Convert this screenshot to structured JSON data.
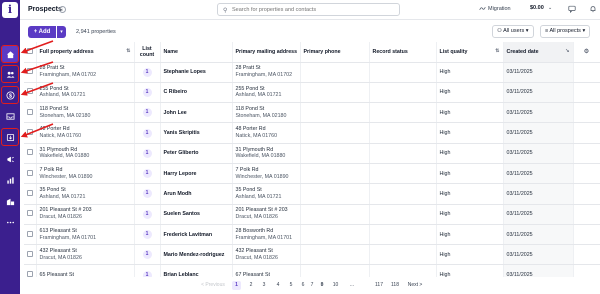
{
  "topbar": {
    "title": "Prospects",
    "search_placeholder": "Search for properties and contacts",
    "migration_label": "Migration",
    "credit_balance": "$0.00"
  },
  "toolbar": {
    "add_label": "+ Add",
    "property_count": "2,941 properties",
    "filter_users": "All users",
    "filter_prospects": "All prospects"
  },
  "table": {
    "columns": {
      "full_address": "Full property address",
      "list_count_1": "List",
      "list_count_2": "count",
      "name": "Name",
      "mailing_address": "Primary mailing address",
      "phone": "Primary phone",
      "record_status": "Record status",
      "list_quality": "List quality",
      "created_date": "Created date"
    },
    "rows": [
      {
        "addr1": "28 Pratt St",
        "addr2": "Framingham, MA 01702",
        "count": "1",
        "name": "Stephanie Lopes",
        "mail1": "28 Pratt St",
        "mail2": "Framingham, MA 01702",
        "quality": "High",
        "created": "03/11/2025"
      },
      {
        "addr1": "255 Pond St",
        "addr2": "Ashland, MA 01721",
        "count": "1",
        "name": "C Ribeiro",
        "mail1": "255 Pond St",
        "mail2": "Ashland, MA 01721",
        "quality": "High",
        "created": "03/11/2025"
      },
      {
        "addr1": "118 Pond St",
        "addr2": "Stoneham, MA 02180",
        "count": "1",
        "name": "John Lee",
        "mail1": "118 Pond St",
        "mail2": "Stoneham, MA 02180",
        "quality": "High",
        "created": "03/11/2025"
      },
      {
        "addr1": "48 Porter Rd",
        "addr2": "Natick, MA 01760",
        "count": "1",
        "name": "Yanis Skripitis",
        "mail1": "48 Porter Rd",
        "mail2": "Natick, MA 01760",
        "quality": "High",
        "created": "03/11/2025"
      },
      {
        "addr1": "31 Plymouth Rd",
        "addr2": "Wakefield, MA 01880",
        "count": "1",
        "name": "Peter Gliberto",
        "mail1": "31 Plymouth Rd",
        "mail2": "Wakefield, MA 01880",
        "quality": "High",
        "created": "03/11/2025"
      },
      {
        "addr1": "7 Polk Rd",
        "addr2": "Winchester, MA 01890",
        "count": "1",
        "name": "Harry Lepore",
        "mail1": "7 Polk Rd",
        "mail2": "Winchester, MA 01890",
        "quality": "High",
        "created": "03/11/2025"
      },
      {
        "addr1": "35 Pond St",
        "addr2": "Ashland, MA 01721",
        "count": "1",
        "name": "Arun Modh",
        "mail1": "35 Pond St",
        "mail2": "Ashland, MA 01721",
        "quality": "High",
        "created": "03/11/2025"
      },
      {
        "addr1": "201 Pleasant St # 203",
        "addr2": "Dracut, MA 01826",
        "count": "1",
        "name": "Suelen Santos",
        "mail1": "201 Pleasant St # 203",
        "mail2": "Dracut, MA 01826",
        "quality": "High",
        "created": "03/11/2025"
      },
      {
        "addr1": "613 Pleasant St",
        "addr2": "Framingham, MA 01701",
        "count": "1",
        "name": "Frederick Lavitman",
        "mail1": "28 Bosworth Rd",
        "mail2": "Framingham, MA 01701",
        "quality": "High",
        "created": "03/11/2025"
      },
      {
        "addr1": "432 Pleasant St",
        "addr2": "Dracut, MA 01826",
        "count": "1",
        "name": "Mario Mendez-rodriguez",
        "mail1": "432 Pleasant St",
        "mail2": "Dracut, MA 01826",
        "quality": "High",
        "created": "03/11/2025"
      },
      {
        "addr1": "65 Pleasant St",
        "addr2": "",
        "count": "1",
        "name": "Brian Leblanc",
        "mail1": "67 Pleasant St",
        "mail2": "",
        "quality": "High",
        "created": "03/11/2025"
      }
    ]
  },
  "pagination": {
    "previous": "< Previous",
    "pages": [
      "1",
      "2",
      "3",
      "4",
      "5",
      "6",
      "7",
      "8",
      "9",
      "10"
    ],
    "ellipsis": "...",
    "tail_pages": [
      "117",
      "118"
    ],
    "next": "Next >"
  },
  "colors": {
    "sidebar": "#3b1f8e",
    "accent": "#5b3bc4",
    "annotation": "#e11d1d"
  }
}
